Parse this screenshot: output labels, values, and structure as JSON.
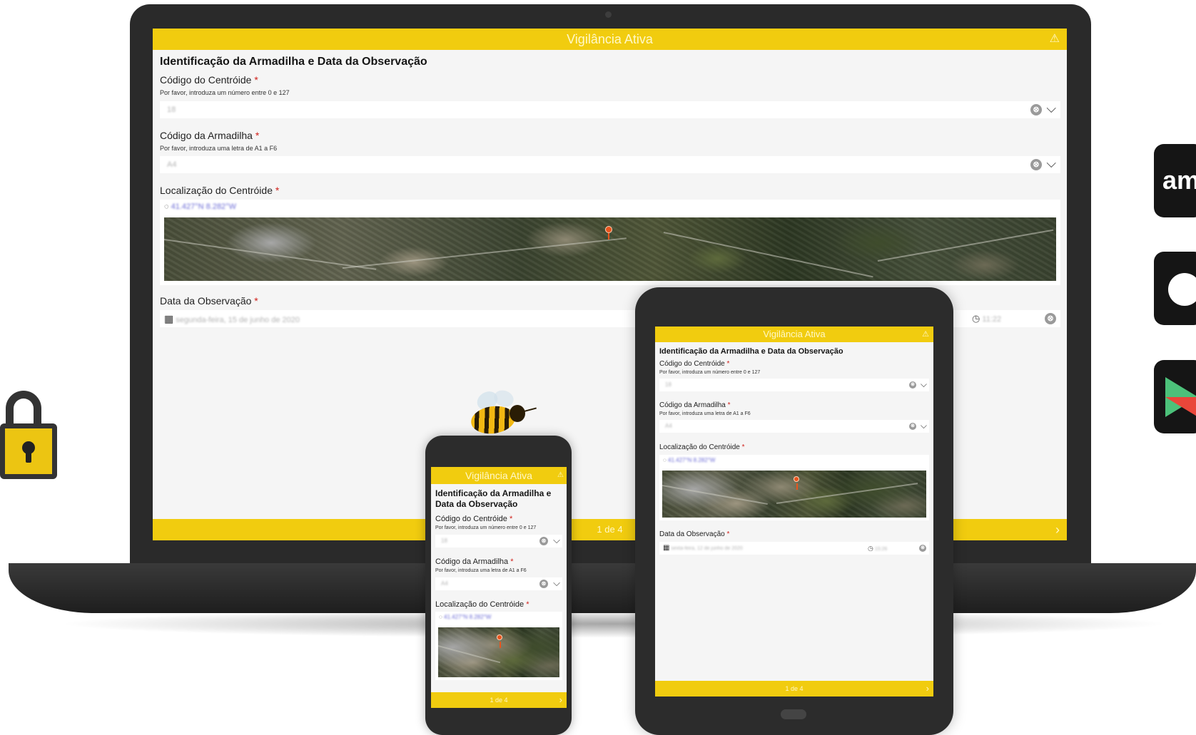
{
  "header_title": "Vigilância Ativa",
  "section_title": "Identificação da Armadilha e Data da Observação",
  "phone_section_title": [
    "Identificação da Armadilha e",
    "Data da Observação"
  ],
  "required_mark": "*",
  "fields": {
    "centroid_code": {
      "label": "Código do Centróide",
      "hint": "Por favor, introduza um número entre 0 e 127",
      "value": "18"
    },
    "trap_code": {
      "label": "Código da Armadilha",
      "hint": "Por favor, introduza uma letra de A1 a F6",
      "value": "A4"
    },
    "centroid_location": {
      "label": "Localização do Centróide",
      "value": "41.427°N 8.282°W"
    },
    "observation_date": {
      "label": "Data da Observação",
      "date_value": "segunda-feira, 15 de junho de 2020",
      "time_value": "11:22"
    }
  },
  "tablet_observation": {
    "date_value": "sexta-feira, 12 de junho de 2020",
    "time_value": "15:26"
  },
  "pagination": "1 de 4",
  "icons": {
    "clear": "⊗",
    "chevron": "⌵",
    "warning": "⚠",
    "next": "›",
    "calendar": "▦",
    "clock": "◷",
    "gps": "◌"
  },
  "badges": {
    "amazon": "am"
  },
  "colors": {
    "header": "#f1cc0f",
    "required": "#d0211b",
    "bezel": "#2a2a2a"
  }
}
